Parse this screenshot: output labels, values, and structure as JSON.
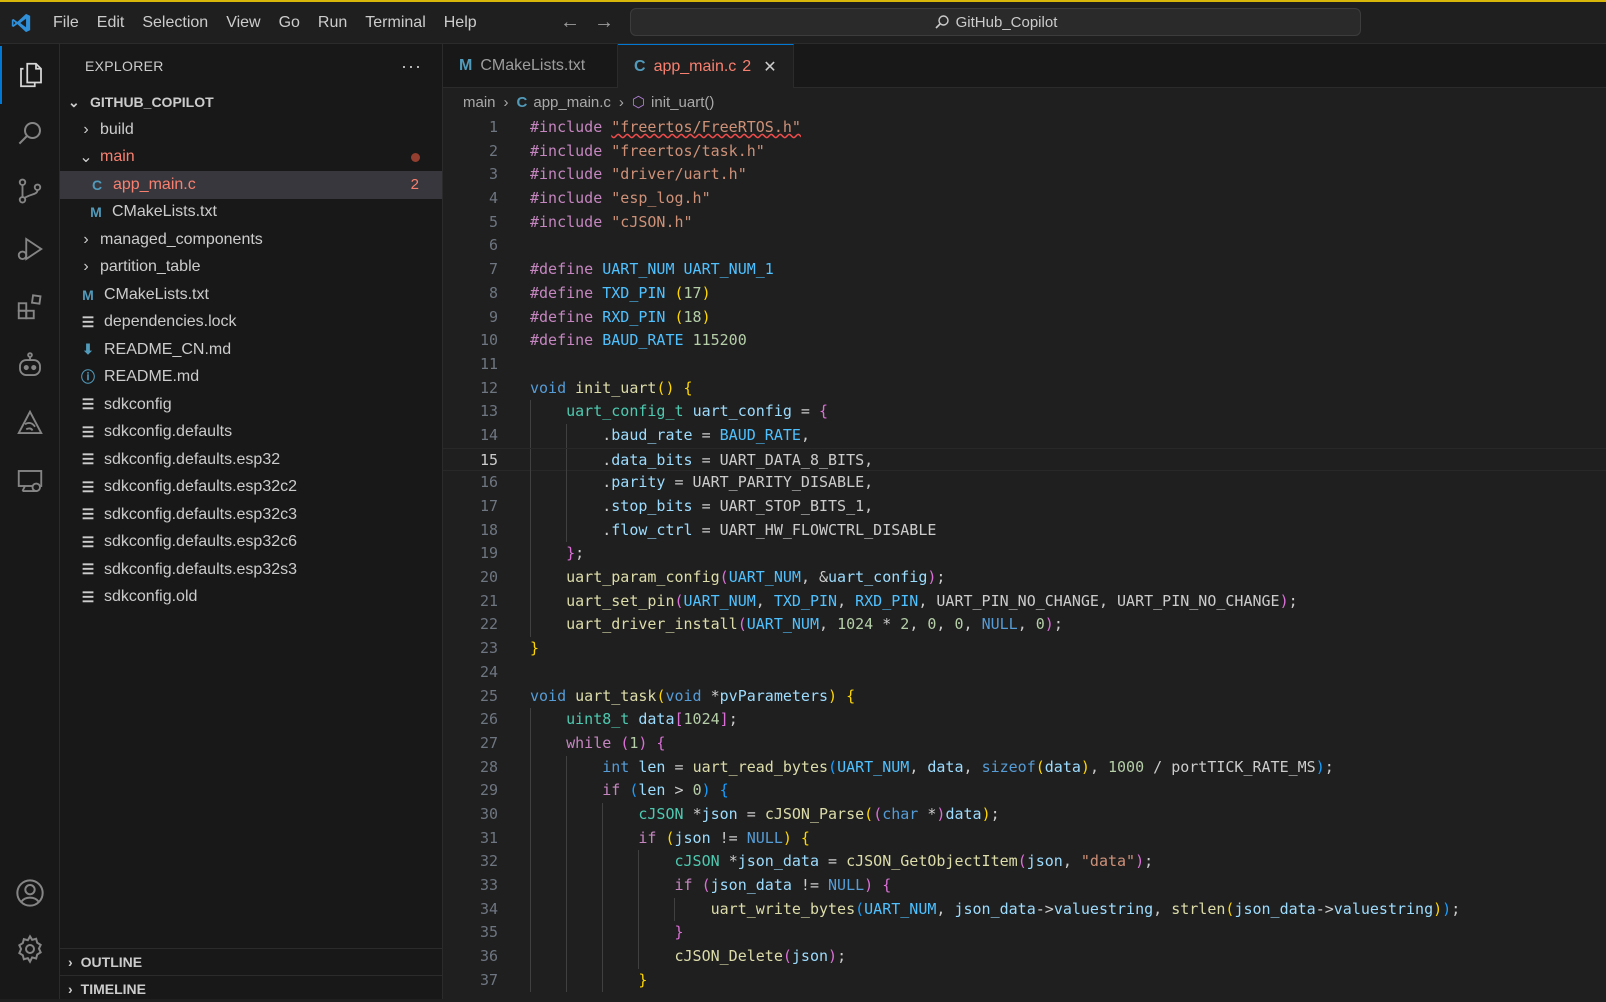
{
  "titlebar": {
    "menu": [
      "File",
      "Edit",
      "Selection",
      "View",
      "Go",
      "Run",
      "Terminal",
      "Help"
    ],
    "search": "GitHub_Copilot"
  },
  "activity_bar": [
    "explorer-icon",
    "search-icon",
    "source-control-icon",
    "run-debug-icon",
    "extensions-icon",
    "copilot-icon",
    "esp-idf-icon",
    "remote-explorer-icon",
    "account-icon",
    "settings-icon"
  ],
  "explorer": {
    "header": "EXPLORER",
    "root": "GITHUB_COPILOT",
    "items": [
      {
        "label": "build",
        "type": "folder",
        "open": false,
        "depth": 1
      },
      {
        "label": "main",
        "type": "folder",
        "open": true,
        "depth": 1,
        "status": "error"
      },
      {
        "label": "app_main.c",
        "type": "c",
        "depth": 2,
        "badge": "2",
        "selected": true,
        "status": "error"
      },
      {
        "label": "CMakeLists.txt",
        "type": "m",
        "depth": 2
      },
      {
        "label": "managed_components",
        "type": "folder",
        "open": false,
        "depth": 1
      },
      {
        "label": "partition_table",
        "type": "folder",
        "open": false,
        "depth": 1
      },
      {
        "label": "CMakeLists.txt",
        "type": "m",
        "depth": 1
      },
      {
        "label": "dependencies.lock",
        "type": "lines",
        "depth": 1
      },
      {
        "label": "README_CN.md",
        "type": "down",
        "depth": 1
      },
      {
        "label": "README.md",
        "type": "info",
        "depth": 1
      },
      {
        "label": "sdkconfig",
        "type": "lines",
        "depth": 1
      },
      {
        "label": "sdkconfig.defaults",
        "type": "lines",
        "depth": 1
      },
      {
        "label": "sdkconfig.defaults.esp32",
        "type": "lines",
        "depth": 1
      },
      {
        "label": "sdkconfig.defaults.esp32c2",
        "type": "lines",
        "depth": 1
      },
      {
        "label": "sdkconfig.defaults.esp32c3",
        "type": "lines",
        "depth": 1
      },
      {
        "label": "sdkconfig.defaults.esp32c6",
        "type": "lines",
        "depth": 1
      },
      {
        "label": "sdkconfig.defaults.esp32s3",
        "type": "lines",
        "depth": 1
      },
      {
        "label": "sdkconfig.old",
        "type": "lines",
        "depth": 1
      }
    ],
    "outline": "OUTLINE",
    "timeline": "TIMELINE"
  },
  "tabs": [
    {
      "label": "CMakeLists.txt",
      "icon": "M",
      "active": false
    },
    {
      "label": "app_main.c",
      "icon": "C",
      "active": true,
      "badge": "2"
    }
  ],
  "breadcrumb": [
    "main",
    "app_main.c",
    "init_uart()"
  ],
  "editor": {
    "current_line": 15,
    "lines": [
      [
        [
          "kw",
          "#include "
        ],
        [
          "str sq",
          "\"freertos/FreeRTOS.h\""
        ]
      ],
      [
        [
          "kw",
          "#include "
        ],
        [
          "str",
          "\"freertos/task.h\""
        ]
      ],
      [
        [
          "kw",
          "#include "
        ],
        [
          "str",
          "\"driver/uart.h\""
        ]
      ],
      [
        [
          "kw",
          "#include "
        ],
        [
          "str",
          "\"esp_log.h\""
        ]
      ],
      [
        [
          "kw",
          "#include "
        ],
        [
          "str",
          "\"cJSON.h\""
        ]
      ],
      [],
      [
        [
          "kw",
          "#define "
        ],
        [
          "mac",
          "UART_NUM "
        ],
        [
          "mac",
          "UART_NUM_1"
        ]
      ],
      [
        [
          "kw",
          "#define "
        ],
        [
          "mac",
          "TXD_PIN "
        ],
        [
          "b1",
          "("
        ],
        [
          "num",
          "17"
        ],
        [
          "b1",
          ")"
        ]
      ],
      [
        [
          "kw",
          "#define "
        ],
        [
          "mac",
          "RXD_PIN "
        ],
        [
          "b1",
          "("
        ],
        [
          "num",
          "18"
        ],
        [
          "b1",
          ")"
        ]
      ],
      [
        [
          "kw",
          "#define "
        ],
        [
          "mac",
          "BAUD_RATE "
        ],
        [
          "num",
          "115200"
        ]
      ],
      [],
      [
        [
          "ty",
          "void "
        ],
        [
          "fn",
          "init_uart"
        ],
        [
          "b1",
          "() {"
        ]
      ],
      [
        [
          "t",
          "    "
        ],
        [
          "cls",
          "uart_config_t "
        ],
        [
          "var",
          "uart_config"
        ],
        [
          "t",
          " = "
        ],
        [
          "b2",
          "{"
        ]
      ],
      [
        [
          "t",
          "        ."
        ],
        [
          "var",
          "baud_rate"
        ],
        [
          "t",
          " = "
        ],
        [
          "mac",
          "BAUD_RATE"
        ],
        [
          "t",
          ","
        ]
      ],
      [
        [
          "t",
          "        ."
        ],
        [
          "var",
          "data_bits"
        ],
        [
          "t",
          " = UART_DATA_8_BITS,"
        ]
      ],
      [
        [
          "t",
          "        ."
        ],
        [
          "var",
          "parity"
        ],
        [
          "t",
          " = UART_PARITY_DISABLE,"
        ]
      ],
      [
        [
          "t",
          "        ."
        ],
        [
          "var",
          "stop_bits"
        ],
        [
          "t",
          " = UART_STOP_BITS_1,"
        ]
      ],
      [
        [
          "t",
          "        ."
        ],
        [
          "var",
          "flow_ctrl"
        ],
        [
          "t",
          " = UART_HW_FLOWCTRL_DISABLE"
        ]
      ],
      [
        [
          "t",
          "    "
        ],
        [
          "b2",
          "}"
        ],
        [
          "t",
          ";"
        ]
      ],
      [
        [
          "t",
          "    "
        ],
        [
          "fn",
          "uart_param_config"
        ],
        [
          "b2",
          "("
        ],
        [
          "mac",
          "UART_NUM"
        ],
        [
          "t",
          ", &"
        ],
        [
          "var",
          "uart_config"
        ],
        [
          "b2",
          ")"
        ],
        [
          "t",
          ";"
        ]
      ],
      [
        [
          "t",
          "    "
        ],
        [
          "fn",
          "uart_set_pin"
        ],
        [
          "b2",
          "("
        ],
        [
          "mac",
          "UART_NUM"
        ],
        [
          "t",
          ", "
        ],
        [
          "mac",
          "TXD_PIN"
        ],
        [
          "t",
          ", "
        ],
        [
          "mac",
          "RXD_PIN"
        ],
        [
          "t",
          ", UART_PIN_NO_CHANGE, UART_PIN_NO_CHANGE"
        ],
        [
          "b2",
          ")"
        ],
        [
          "t",
          ";"
        ]
      ],
      [
        [
          "t",
          "    "
        ],
        [
          "fn",
          "uart_driver_install"
        ],
        [
          "b2",
          "("
        ],
        [
          "mac",
          "UART_NUM"
        ],
        [
          "t",
          ", "
        ],
        [
          "num",
          "1024"
        ],
        [
          "t",
          " * "
        ],
        [
          "num",
          "2"
        ],
        [
          "t",
          ", "
        ],
        [
          "num",
          "0"
        ],
        [
          "t",
          ", "
        ],
        [
          "num",
          "0"
        ],
        [
          "t",
          ", "
        ],
        [
          "ty",
          "NULL"
        ],
        [
          "t",
          ", "
        ],
        [
          "num",
          "0"
        ],
        [
          "b2",
          ")"
        ],
        [
          "t",
          ";"
        ]
      ],
      [
        [
          "b1",
          "}"
        ]
      ],
      [],
      [
        [
          "ty",
          "void "
        ],
        [
          "fn",
          "uart_task"
        ],
        [
          "b1",
          "("
        ],
        [
          "ty",
          "void "
        ],
        [
          "t",
          "*"
        ],
        [
          "var",
          "pvParameters"
        ],
        [
          "b1",
          ")"
        ],
        [
          "b1",
          " {"
        ]
      ],
      [
        [
          "t",
          "    "
        ],
        [
          "cls",
          "uint8_t "
        ],
        [
          "var",
          "data"
        ],
        [
          "b2",
          "["
        ],
        [
          "num",
          "1024"
        ],
        [
          "b2",
          "]"
        ],
        [
          "t",
          ";"
        ]
      ],
      [
        [
          "t",
          "    "
        ],
        [
          "kw",
          "while "
        ],
        [
          "b2",
          "("
        ],
        [
          "num",
          "1"
        ],
        [
          "b2",
          ")"
        ],
        [
          "b2",
          " {"
        ]
      ],
      [
        [
          "t",
          "        "
        ],
        [
          "ty",
          "int "
        ],
        [
          "var",
          "len"
        ],
        [
          "t",
          " = "
        ],
        [
          "fn",
          "uart_read_bytes"
        ],
        [
          "b3",
          "("
        ],
        [
          "mac",
          "UART_NUM"
        ],
        [
          "t",
          ", "
        ],
        [
          "var",
          "data"
        ],
        [
          "t",
          ", "
        ],
        [
          "ty",
          "sizeof"
        ],
        [
          "b1",
          "("
        ],
        [
          "var",
          "data"
        ],
        [
          "b1",
          ")"
        ],
        [
          "t",
          ", "
        ],
        [
          "num",
          "1000"
        ],
        [
          "t",
          " / portTICK_RATE_MS"
        ],
        [
          "b3",
          ")"
        ],
        [
          "t",
          ";"
        ]
      ],
      [
        [
          "t",
          "        "
        ],
        [
          "kw",
          "if "
        ],
        [
          "b3",
          "("
        ],
        [
          "var",
          "len"
        ],
        [
          "t",
          " > "
        ],
        [
          "num",
          "0"
        ],
        [
          "b3",
          ")"
        ],
        [
          "b3",
          " {"
        ]
      ],
      [
        [
          "t",
          "            "
        ],
        [
          "cls",
          "cJSON "
        ],
        [
          "t",
          "*"
        ],
        [
          "var",
          "json"
        ],
        [
          "t",
          " = "
        ],
        [
          "fn",
          "cJSON_Parse"
        ],
        [
          "b1",
          "("
        ],
        [
          "b2",
          "("
        ],
        [
          "ty",
          "char "
        ],
        [
          "t",
          "*"
        ],
        [
          "b2",
          ")"
        ],
        [
          "var",
          "data"
        ],
        [
          "b1",
          ")"
        ],
        [
          "t",
          ";"
        ]
      ],
      [
        [
          "t",
          "            "
        ],
        [
          "kw",
          "if "
        ],
        [
          "b1",
          "("
        ],
        [
          "var",
          "json"
        ],
        [
          "t",
          " != "
        ],
        [
          "ty",
          "NULL"
        ],
        [
          "b1",
          ")"
        ],
        [
          "b1",
          " {"
        ]
      ],
      [
        [
          "t",
          "                "
        ],
        [
          "cls",
          "cJSON "
        ],
        [
          "t",
          "*"
        ],
        [
          "var",
          "json_data"
        ],
        [
          "t",
          " = "
        ],
        [
          "fn",
          "cJSON_GetObjectItem"
        ],
        [
          "b2",
          "("
        ],
        [
          "var",
          "json"
        ],
        [
          "t",
          ", "
        ],
        [
          "str",
          "\"data\""
        ],
        [
          "b2",
          ")"
        ],
        [
          "t",
          ";"
        ]
      ],
      [
        [
          "t",
          "                "
        ],
        [
          "kw",
          "if "
        ],
        [
          "b2",
          "("
        ],
        [
          "var",
          "json_data"
        ],
        [
          "t",
          " != "
        ],
        [
          "ty",
          "NULL"
        ],
        [
          "b2",
          ")"
        ],
        [
          "b2",
          " {"
        ]
      ],
      [
        [
          "t",
          "                    "
        ],
        [
          "fn",
          "uart_write_bytes"
        ],
        [
          "b3",
          "("
        ],
        [
          "mac",
          "UART_NUM"
        ],
        [
          "t",
          ", "
        ],
        [
          "var",
          "json_data"
        ],
        [
          "t",
          "->"
        ],
        [
          "var",
          "valuestring"
        ],
        [
          "t",
          ", "
        ],
        [
          "fn",
          "strlen"
        ],
        [
          "b1",
          "("
        ],
        [
          "var",
          "json_data"
        ],
        [
          "t",
          "->"
        ],
        [
          "var",
          "valuestring"
        ],
        [
          "b1",
          ")"
        ],
        [
          "b3",
          ")"
        ],
        [
          "t",
          ";"
        ]
      ],
      [
        [
          "t",
          "                "
        ],
        [
          "b2",
          "}"
        ]
      ],
      [
        [
          "t",
          "                "
        ],
        [
          "fn",
          "cJSON_Delete"
        ],
        [
          "b2",
          "("
        ],
        [
          "var",
          "json"
        ],
        [
          "b2",
          ")"
        ],
        [
          "t",
          ";"
        ]
      ],
      [
        [
          "t",
          "            "
        ],
        [
          "b1",
          "}"
        ]
      ]
    ]
  }
}
